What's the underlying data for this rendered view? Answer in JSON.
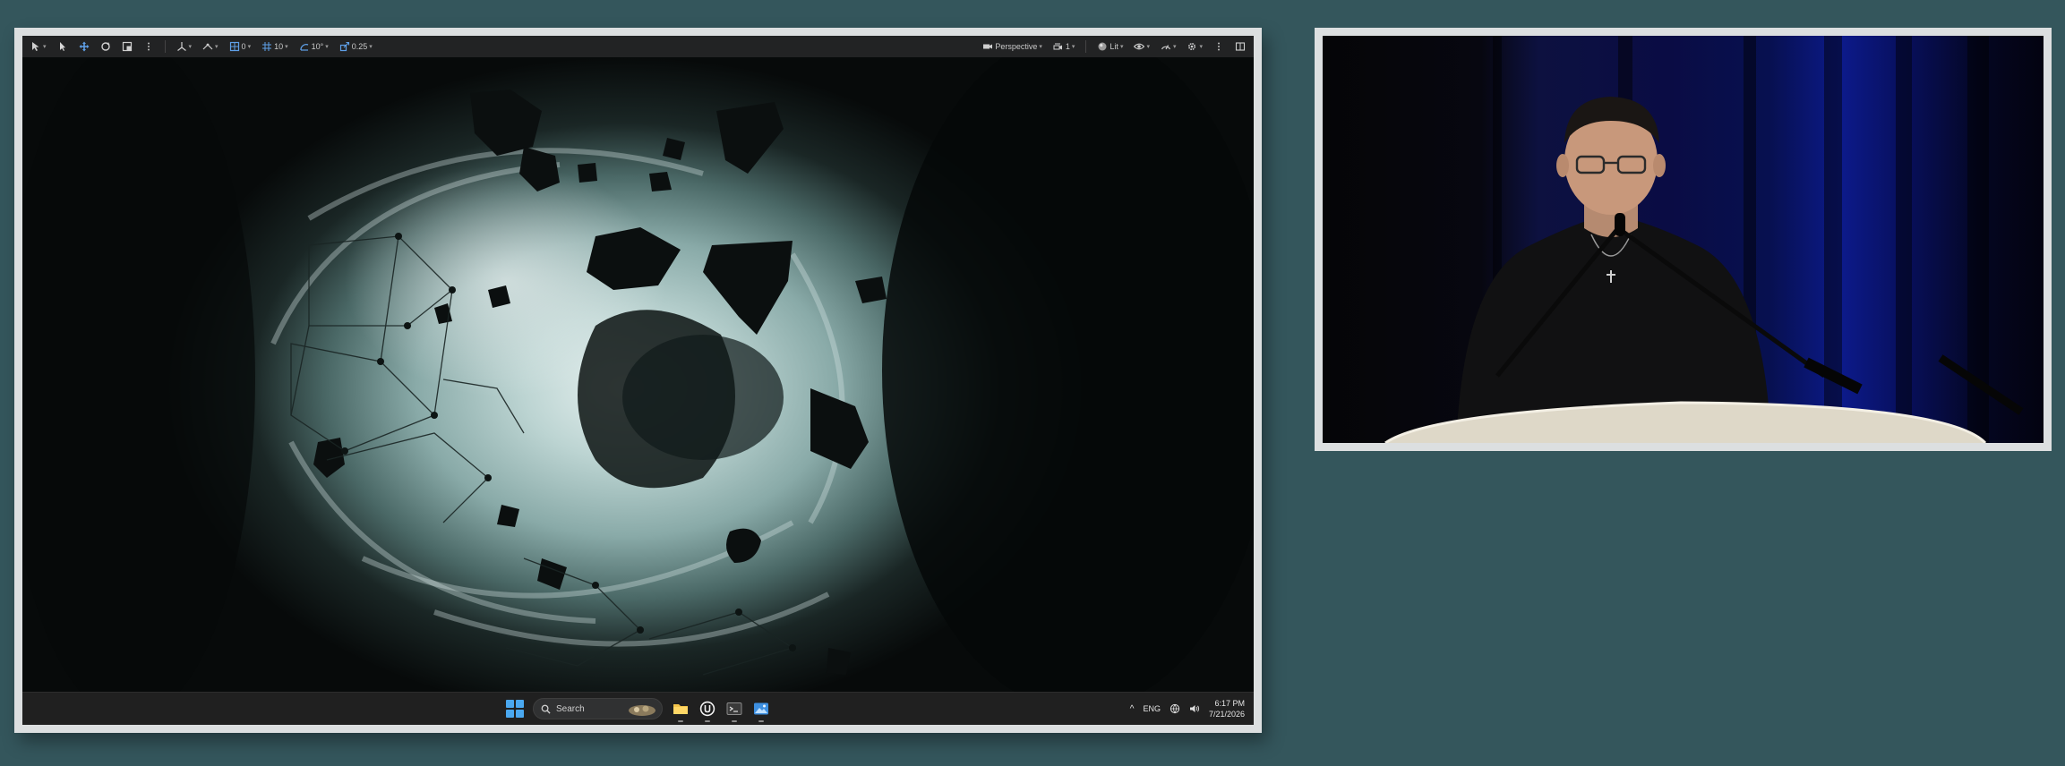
{
  "editor_toolbar": {
    "snap_translate_value": "0",
    "grid_size_value": "10",
    "rotation_snap_value": "10°",
    "scale_snap_value": "0.25",
    "viewport_mode_label": "Perspective",
    "camera_speed_value": "1",
    "view_mode_label": "Lit"
  },
  "taskbar": {
    "search_placeholder": "Search",
    "language": "ENG",
    "time": "6:17 PM",
    "date": "7/21/2026"
  },
  "colors": {
    "background": "#34565c",
    "frame_border": "#dcdfe0",
    "toolbar": "#222324",
    "taskbar": "#202020",
    "windows_accent": "#4aa8f0"
  }
}
